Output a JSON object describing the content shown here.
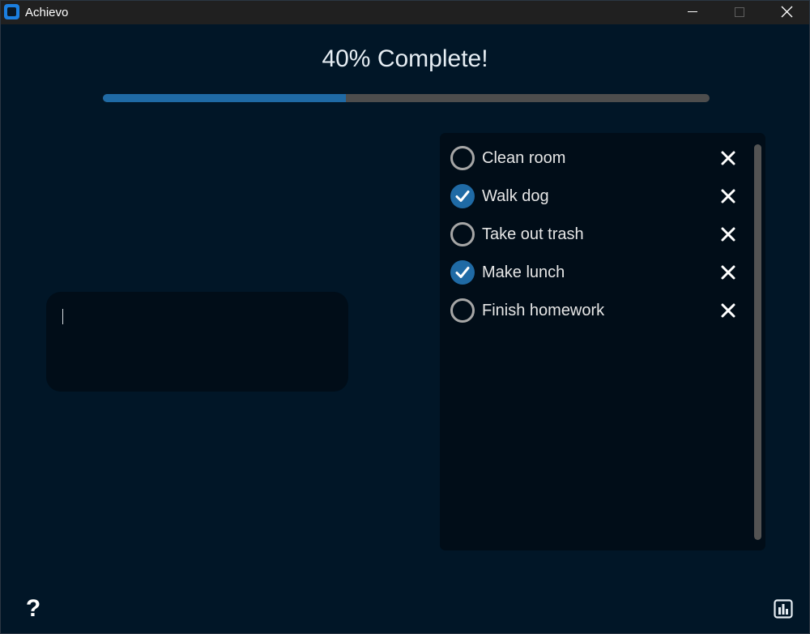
{
  "window": {
    "title": "Achievo",
    "icon": "achievo-app-icon"
  },
  "progress": {
    "title": "40% Complete!",
    "fraction": 0.4,
    "fill_color": "#1f6aa5",
    "track_color": "#4d4d4d"
  },
  "input": {
    "value": "",
    "placeholder": ""
  },
  "tasks": [
    {
      "label": "Clean room",
      "done": false
    },
    {
      "label": "Walk dog",
      "done": true
    },
    {
      "label": "Take out trash",
      "done": false
    },
    {
      "label": "Make lunch",
      "done": true
    },
    {
      "label": "Finish homework",
      "done": false
    }
  ],
  "footer": {
    "help_label": "?",
    "help_icon": "question-mark-icon",
    "stats_icon": "bar-chart-icon"
  },
  "colors": {
    "background": "#011627",
    "panel": "#010d18",
    "accent": "#1f6aa5",
    "unchecked_ring": "#a6a6a6"
  }
}
